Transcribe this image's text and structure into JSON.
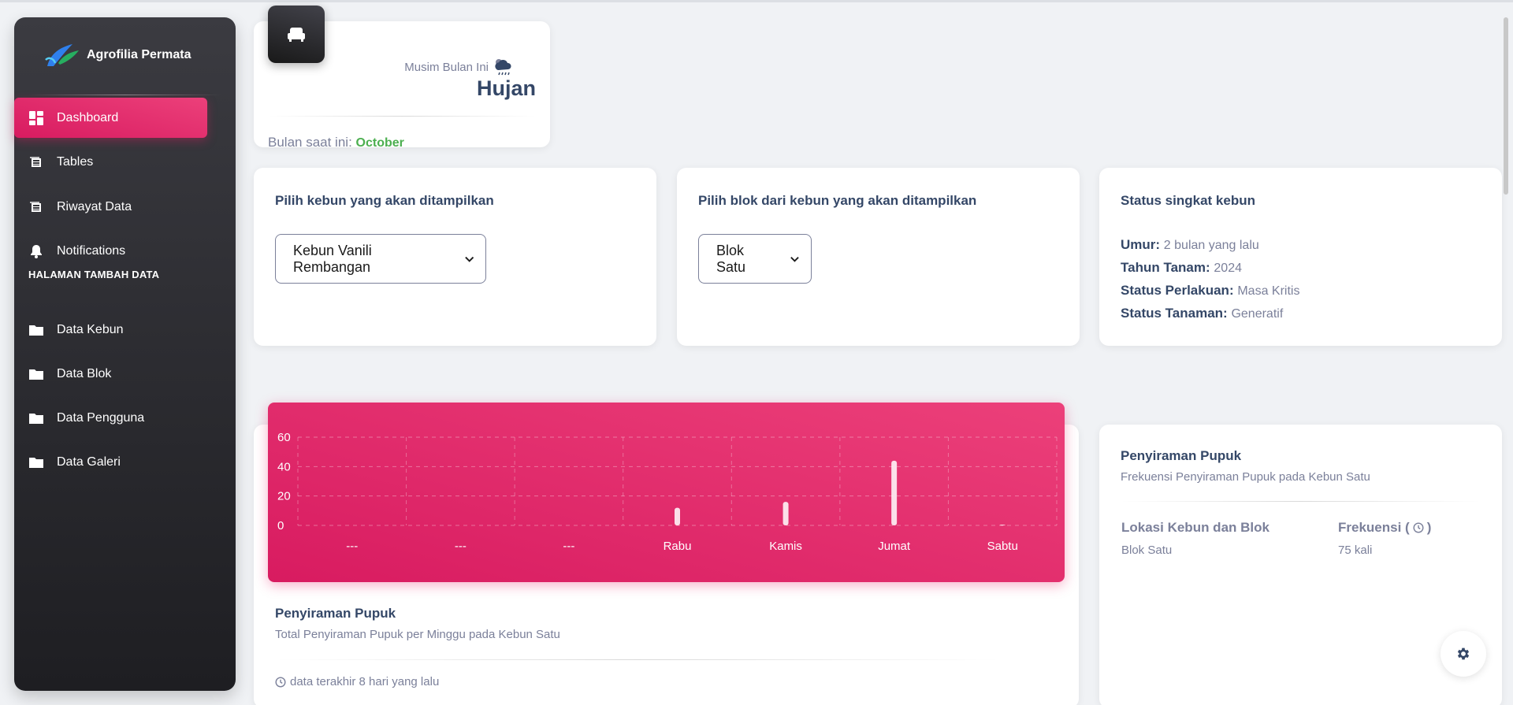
{
  "sidebar": {
    "brand_name": "Agrofilia Permata",
    "items": [
      {
        "label": "Dashboard",
        "icon": "dashboard-icon"
      },
      {
        "label": "Tables",
        "icon": "table-icon"
      },
      {
        "label": "Riwayat Data",
        "icon": "table-icon"
      },
      {
        "label": "Notifications",
        "icon": "bell-icon"
      }
    ],
    "section_title": "HALAMAN TAMBAH DATA",
    "data_items": [
      {
        "label": "Data Kebun",
        "icon": "folder-icon"
      },
      {
        "label": "Data Blok",
        "icon": "folder-icon"
      },
      {
        "label": "Data Pengguna",
        "icon": "folder-icon"
      },
      {
        "label": "Data Galeri",
        "icon": "folder-icon"
      }
    ]
  },
  "season": {
    "label": "Musim Bulan Ini",
    "value": "Hujan",
    "month_label": "Bulan saat ini:",
    "month": "October"
  },
  "kebun_select": {
    "title": "Pilih kebun yang akan ditampilkan",
    "value": "Kebun Vanili Rembangan"
  },
  "blok_select": {
    "title": "Pilih blok dari kebun yang akan ditampilkan",
    "value": "Blok Satu"
  },
  "status": {
    "title": "Status singkat kebun",
    "umur_label": "Umur:",
    "umur": "2 bulan yang lalu",
    "tahun_label": "Tahun Tanam:",
    "tahun": "2024",
    "perlakuan_label": "Status Perlakuan:",
    "perlakuan": "Masa Kritis",
    "tanaman_label": "Status Tanaman:",
    "tanaman": "Generatif"
  },
  "chart_card": {
    "title": "Penyiraman Pupuk",
    "subtitle": "Total Penyiraman Pupuk per Minggu pada Kebun Satu",
    "footer": "data terakhir 8 hari yang lalu"
  },
  "chart_data": {
    "type": "bar",
    "categories": [
      "---",
      "---",
      "---",
      "Rabu",
      "Kamis",
      "Jumat",
      "Sabtu"
    ],
    "values": [
      0,
      0,
      0,
      12,
      16,
      44,
      0.5
    ],
    "ylim": [
      0,
      60
    ],
    "yticks": [
      0,
      20,
      40,
      60
    ],
    "grid": true
  },
  "freq_card": {
    "title": "Penyiraman Pupuk",
    "subtitle": "Frekuensi Penyiraman Pupuk pada Kebun Satu",
    "col1_header": "Lokasi Kebun dan Blok",
    "col2_header_pre": "Frekuensi (",
    "col2_header_post": ")",
    "location": "Blok Satu",
    "frequency": "75 kali"
  },
  "colors": {
    "accent": "#e91e63",
    "sidebar_dark": "#1e1e22",
    "month_green": "#4caf50"
  }
}
